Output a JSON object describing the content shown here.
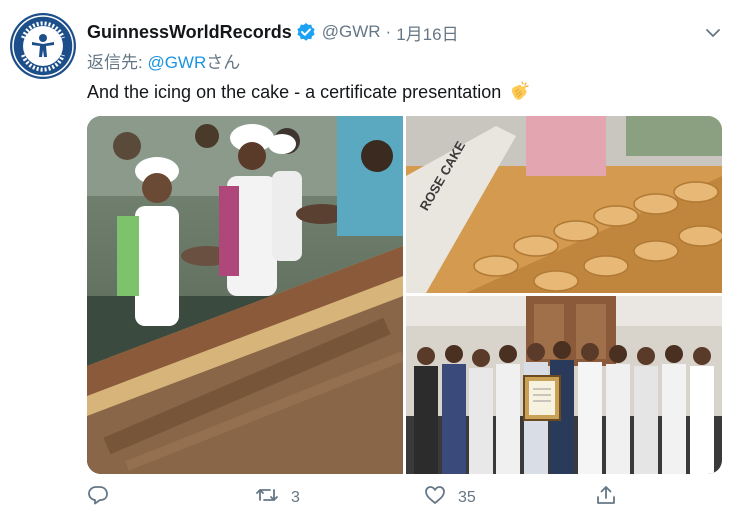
{
  "account": {
    "display_name": "GuinnessWorldRecords",
    "handle": "@GWR",
    "separator": "·",
    "timestamp": "1月16日",
    "verified": true,
    "avatar_icon": "guinness-world-records-logo"
  },
  "reply": {
    "prefix": "返信先: ",
    "mention": "@GWR",
    "suffix": "さん"
  },
  "tweet": {
    "text": "And the icing on the cake - a certificate presentation",
    "emoji": "clapping-hands"
  },
  "media": {
    "count": 3,
    "sign_text": "ROSE CAKE"
  },
  "actions": {
    "reply_count": "",
    "retweet_count": "3",
    "like_count": "35",
    "share_icon": "share-icon"
  },
  "colors": {
    "text": "#14171a",
    "secondary": "#657786",
    "link": "#1b95e0",
    "verified": "#1da1f2",
    "avatar_bg": "#1c4e8a"
  }
}
